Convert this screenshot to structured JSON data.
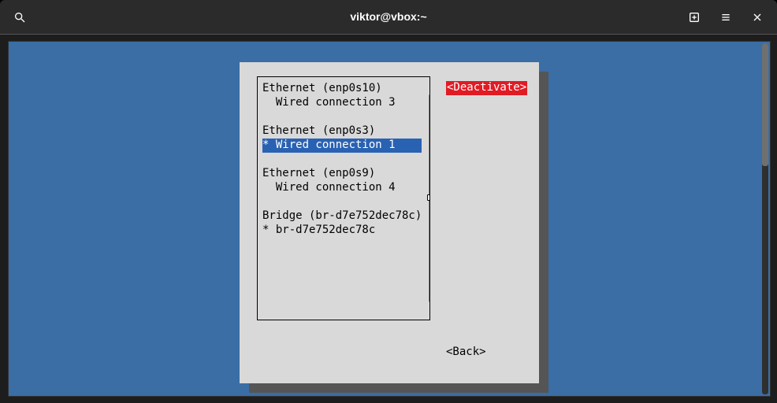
{
  "window": {
    "title": "viktor@vbox:~"
  },
  "tui": {
    "list": {
      "groups": [
        {
          "title": "Ethernet (enp0s10)",
          "conn_label": "  Wired connection 3",
          "active": false,
          "selected": false
        },
        {
          "title": "Ethernet (enp0s3)",
          "conn_label": "* Wired connection 1",
          "active": true,
          "selected": true
        },
        {
          "title": "Ethernet (enp0s9)",
          "conn_label": "  Wired connection 4",
          "active": false,
          "selected": false
        },
        {
          "title": "Bridge (br-d7e752dec78c)",
          "conn_label": "* br-d7e752dec78c",
          "active": true,
          "selected": false
        }
      ],
      "scroll_arrows": {
        "up": "↑",
        "down": "↓"
      }
    },
    "buttons": {
      "deactivate": "<Deactivate>",
      "back": "<Back>"
    }
  }
}
